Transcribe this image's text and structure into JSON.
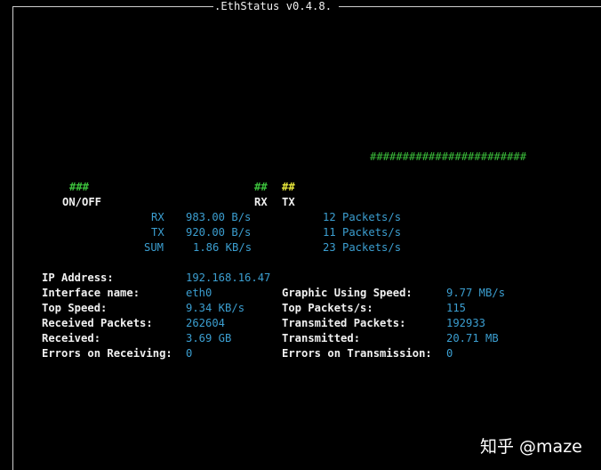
{
  "window": {
    "title": ".EthStatus v0.4.8."
  },
  "graph": {
    "bar_top": "########################",
    "rx_marker": "###",
    "rx_bar": "##",
    "tx_bar": "##",
    "onoff_label": "ON/OFF",
    "rx_label": "RX",
    "tx_label": "TX"
  },
  "speeds": [
    {
      "label": "RX",
      "speed": "983.00 B/s",
      "packets": "12 Packets/s"
    },
    {
      "label": "TX",
      "speed": "920.00 B/s",
      "packets": "11 Packets/s"
    },
    {
      "label": "SUM",
      "speed": "1.86 KB/s",
      "packets": "23 Packets/s"
    }
  ],
  "stats_left": [
    {
      "label": "IP Address:",
      "value": "192.168.16.47"
    },
    {
      "label": "Interface name:",
      "value": "eth0"
    },
    {
      "label": "Top Speed:",
      "value": "9.34 KB/s"
    },
    {
      "label": "Received Packets:",
      "value": "262604"
    },
    {
      "label": "Received:",
      "value": "3.69 GB"
    },
    {
      "label": "Errors on Receiving:",
      "value": "0"
    }
  ],
  "stats_right": [
    {
      "label": "Graphic Using Speed:",
      "value": "9.77 MB/s"
    },
    {
      "label": "Top Packets/s:",
      "value": "115"
    },
    {
      "label": "Transmited Packets:",
      "value": "192933"
    },
    {
      "label": "Transmitted:",
      "value": "20.71 MB"
    },
    {
      "label": "Errors on Transmission:",
      "value": "0"
    }
  ],
  "watermark": {
    "text": "知乎 @maze"
  },
  "colors": {
    "background": "#000000",
    "label": "#f0f0f0",
    "value": "#3b9ed0",
    "rx_graph": "#3bbf3b",
    "tx_graph": "#e6e63a"
  }
}
